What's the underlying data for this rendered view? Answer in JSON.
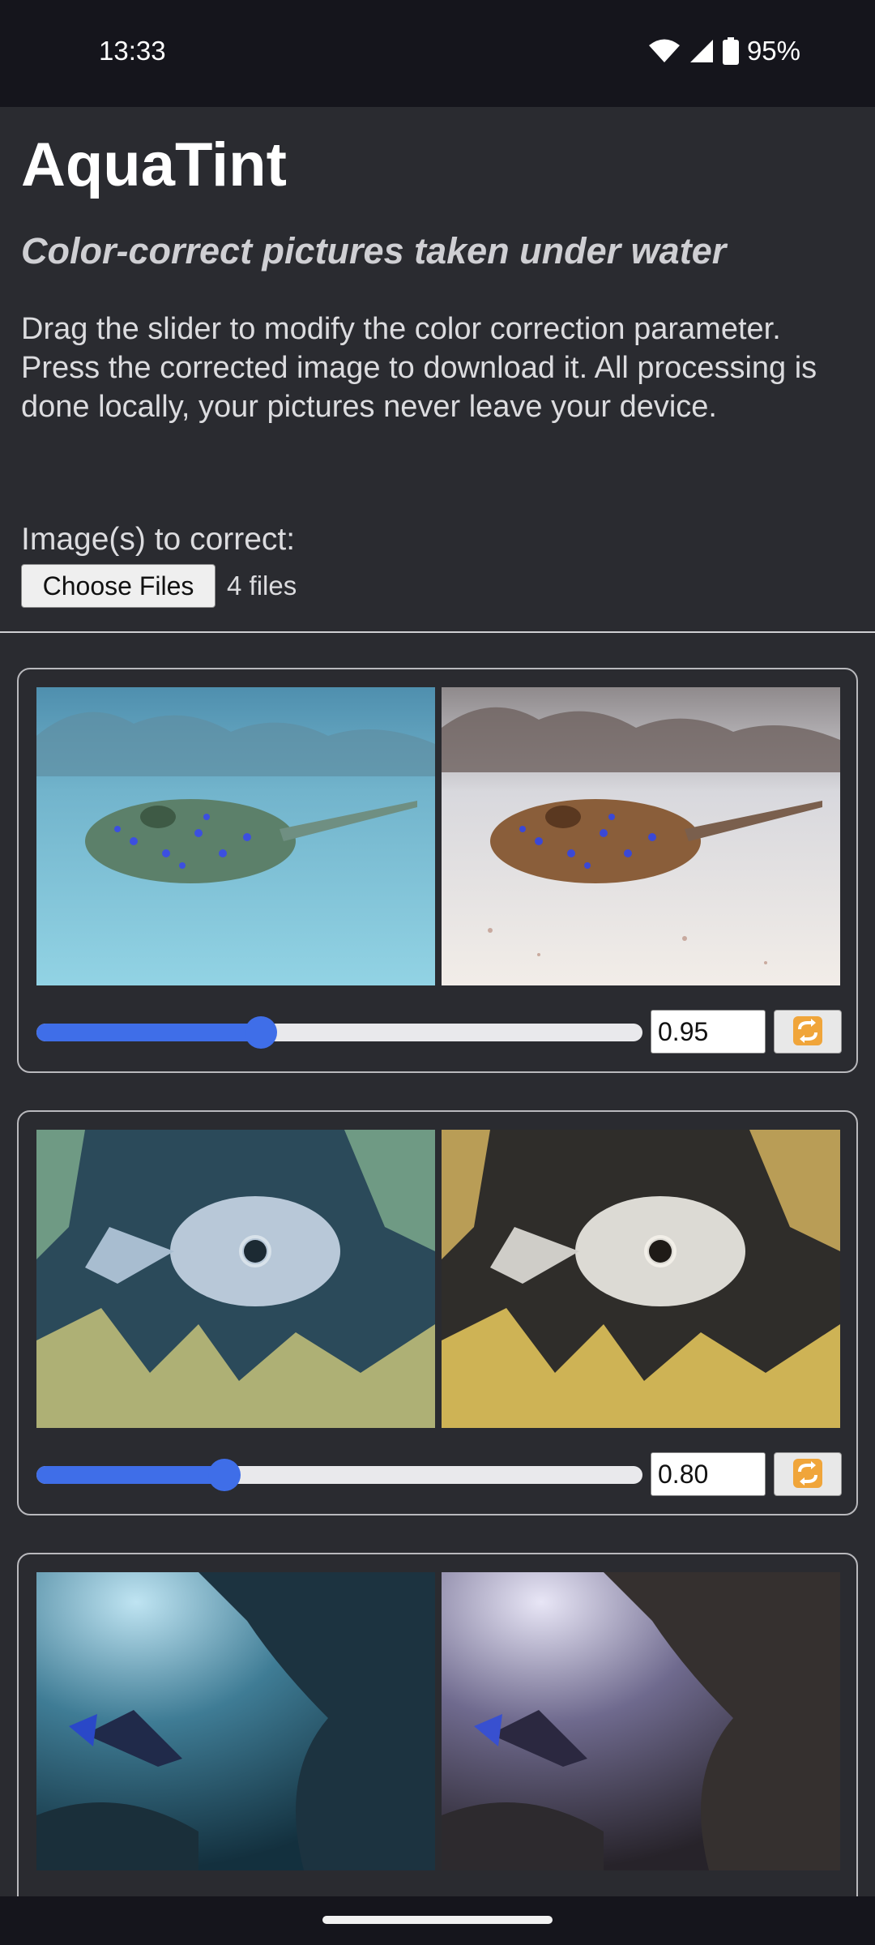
{
  "status_bar": {
    "time": "13:33",
    "battery": "95%"
  },
  "header": {
    "title": "AquaTint",
    "subtitle": "Color-correct pictures taken under water",
    "description": "Drag the slider to modify the color correction parameter. Press the corrected image to download it. All processing is done locally, your pictures never leave your device."
  },
  "file_picker": {
    "label": "Image(s) to correct:",
    "button_label": "Choose Files",
    "status": "4 files"
  },
  "images": [
    {
      "subject": "stingray",
      "value": "0.95",
      "slider_fraction": 0.37
    },
    {
      "subject": "pufferfish",
      "value": "0.80",
      "slider_fraction": 0.31
    },
    {
      "subject": "diver-cave",
      "value": "",
      "slider_fraction": null
    }
  ],
  "icons": {
    "reset": "refresh-icon",
    "wifi": "wifi-icon",
    "signal": "signal-icon",
    "battery": "battery-icon"
  },
  "colors": {
    "accent": "#3f6ee8",
    "reset_icon": "#f0a53a",
    "background": "#2a2b30"
  }
}
